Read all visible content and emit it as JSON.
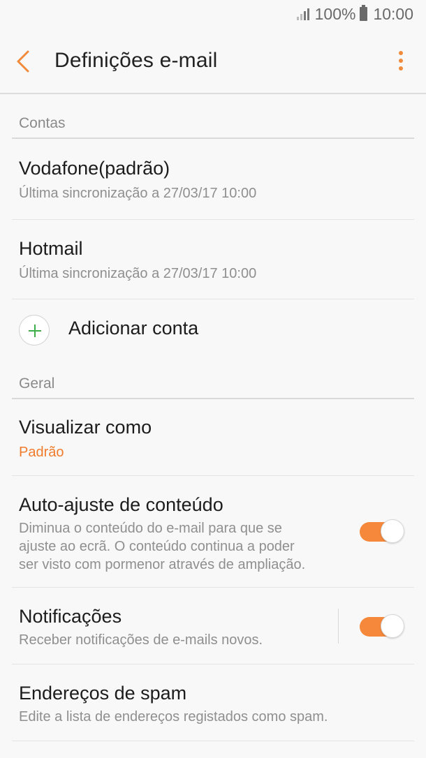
{
  "status_bar": {
    "battery": "100%",
    "time": "10:00"
  },
  "app_bar": {
    "title": "Definições e-mail",
    "accent_color": "#f08a3c"
  },
  "sections": {
    "accounts": {
      "header": "Contas",
      "items": [
        {
          "title": "Vodafone(padrão)",
          "subtitle": "Última sincronização a 27/03/17  10:00"
        },
        {
          "title": "Hotmail",
          "subtitle": "Última sincronização a 27/03/17  10:00"
        }
      ],
      "add_label": "Adicionar conta"
    },
    "general": {
      "header": "Geral",
      "view_as": {
        "title": "Visualizar como",
        "value": "Padrão"
      },
      "auto_fit": {
        "title": "Auto-ajuste de conteúdo",
        "desc_lines": [
          "Diminua o conteúdo do e-mail para que se",
          "ajuste ao ecrã. O conteúdo continua a poder",
          "ser visto com pormenor através de ampliação."
        ],
        "enabled": true
      },
      "notifications": {
        "title": "Notificações",
        "desc": "Receber notificações de e-mails novos.",
        "enabled": true
      },
      "spam": {
        "title": "Endereços de spam",
        "desc": "Edite a lista de endereços registados como spam."
      }
    }
  }
}
